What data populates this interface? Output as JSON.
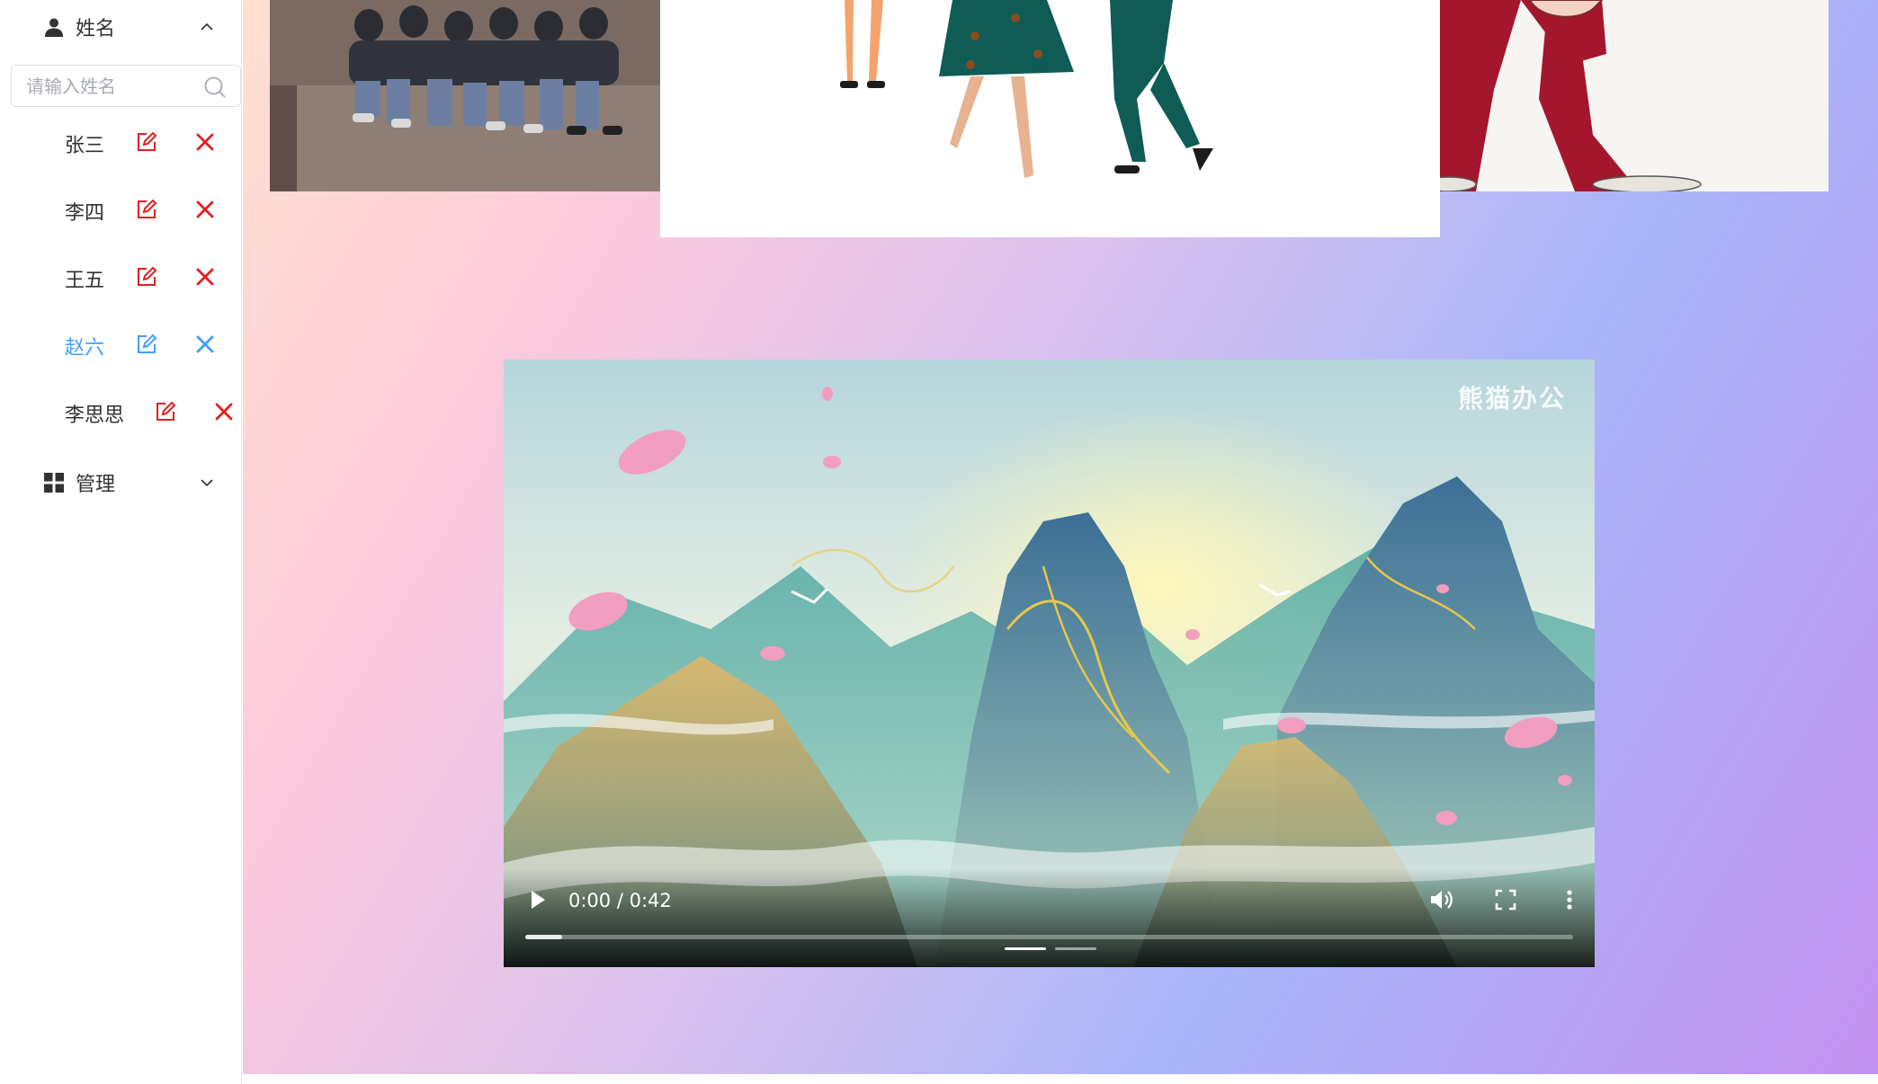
{
  "sidebar": {
    "name_menu": {
      "label": "姓名",
      "icon": "user-icon",
      "expanded": true
    },
    "search": {
      "placeholder": "请输入姓名",
      "value": ""
    },
    "names": [
      {
        "name": "张三",
        "active": false
      },
      {
        "name": "李四",
        "active": false
      },
      {
        "name": "王五",
        "active": false
      },
      {
        "name": "赵六",
        "active": true
      },
      {
        "name": "李思思",
        "active": false
      }
    ],
    "manage_menu": {
      "label": "管理",
      "icon": "grid-icon",
      "expanded": false
    }
  },
  "video": {
    "watermark": "熊猫办公",
    "time": "0:00 / 0:42",
    "progress": 0.0,
    "buffered": 0.035
  },
  "colors": {
    "accent": "#409eff",
    "danger": "#e02020",
    "text": "#303133"
  }
}
